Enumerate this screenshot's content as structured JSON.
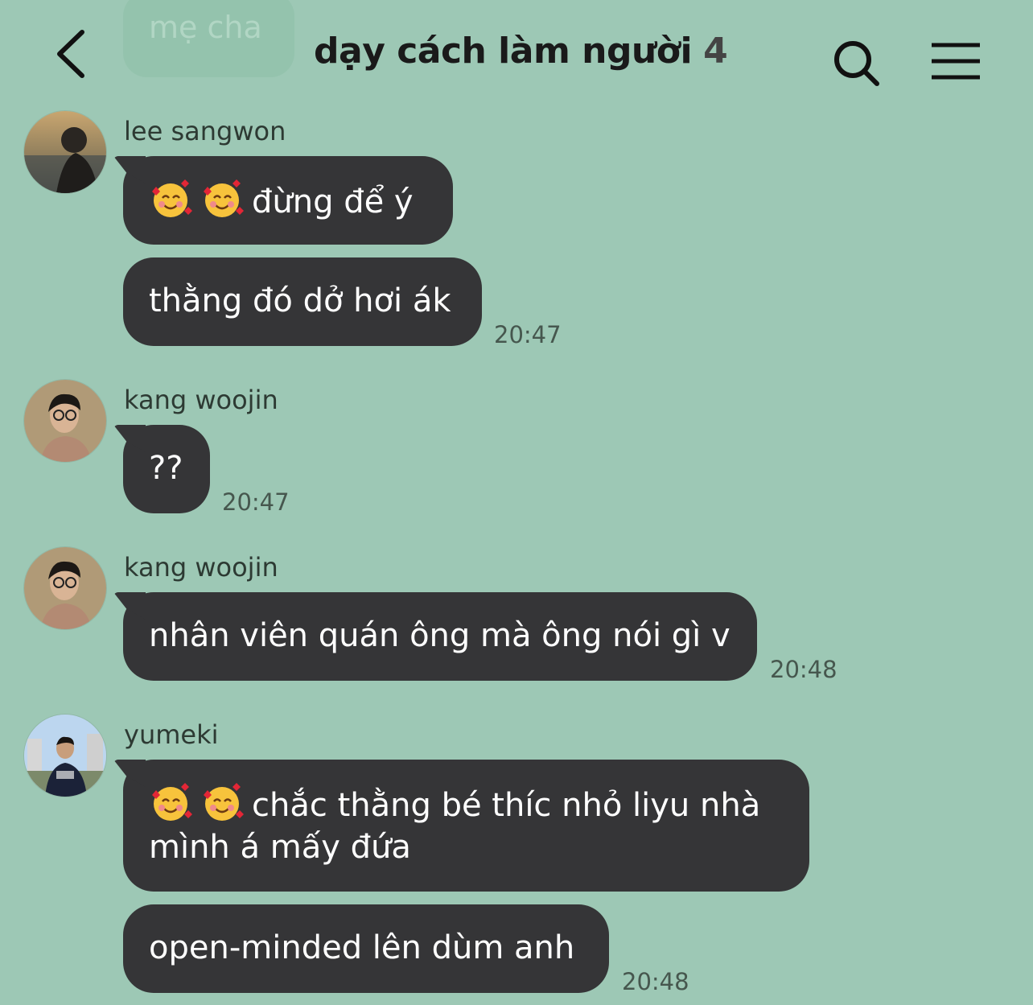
{
  "header": {
    "title": "dạy cách làm người",
    "member_count": "4",
    "ghost_bubble_text": "mẹ cha"
  },
  "messages": [
    {
      "sender": "lee sangwon",
      "avatar": "avatar-lee-sangwon",
      "bubbles": [
        {
          "emojis": 2,
          "text": "đừng để ý"
        },
        {
          "emojis": 0,
          "text": "thằng đó dở hơi ák"
        }
      ],
      "time": "20:47"
    },
    {
      "sender": "kang woojin",
      "avatar": "avatar-kang-woojin",
      "bubbles": [
        {
          "emojis": 0,
          "text": "??"
        }
      ],
      "time": "20:47"
    },
    {
      "sender": "kang woojin",
      "avatar": "avatar-kang-woojin",
      "bubbles": [
        {
          "emojis": 0,
          "text": "nhân viên quán ông mà ông nói gì v"
        }
      ],
      "time": "20:48"
    },
    {
      "sender": "yumeki",
      "avatar": "avatar-yumeki",
      "bubbles": [
        {
          "emojis": 2,
          "text": "chắc thằng bé thíc nhỏ liyu nhà",
          "text_line2": "mình á mấy đứa"
        },
        {
          "emojis": 0,
          "text": "open-minded lên dùm anh"
        }
      ],
      "time": "20:48"
    }
  ],
  "icons": {
    "back": "chevron-left-icon",
    "search": "search-icon",
    "menu": "hamburger-menu-icon",
    "emoji": "smiling-face-with-hearts-emoji"
  },
  "colors": {
    "background": "#9dc8b5",
    "bubble": "#353537",
    "bubble_text": "#ffffff"
  }
}
